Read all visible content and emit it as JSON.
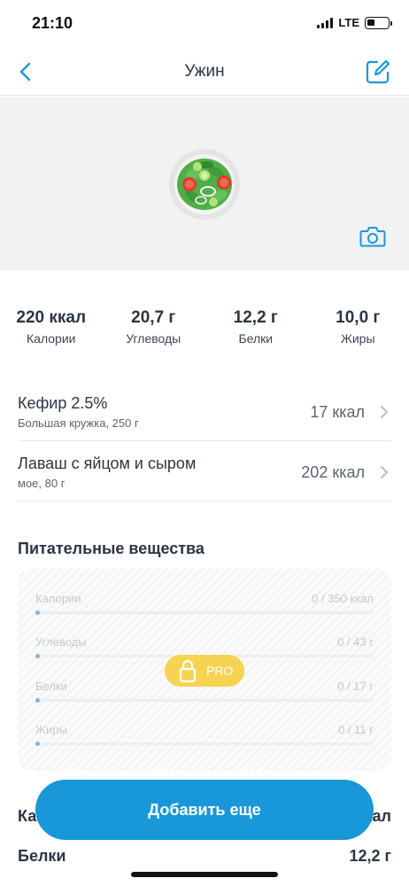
{
  "status_bar": {
    "time": "21:10",
    "network": "LTE",
    "signal_bars": 4,
    "battery_level": 0.35
  },
  "nav": {
    "title": "Ужин",
    "back_icon": "chevron-left-icon",
    "edit_icon": "edit-icon"
  },
  "photo": {
    "food_icon": "salad-icon",
    "camera_icon": "camera-icon"
  },
  "macros": [
    {
      "value": "220 ккал",
      "label": "Калории"
    },
    {
      "value": "20,7 г",
      "label": "Углеводы"
    },
    {
      "value": "12,2 г",
      "label": "Белки"
    },
    {
      "value": "10,0 г",
      "label": "Жиры"
    }
  ],
  "items": [
    {
      "name": "Кефир 2.5%",
      "subtitle": "Большая кружка, 250 г",
      "kcal": "17 ккал"
    },
    {
      "name": "Лаваш с яйцом и сыром",
      "subtitle": "мое, 80 г",
      "kcal": "202 ккал"
    }
  ],
  "nutrients": {
    "title": "Питательные вещества",
    "pro_label": "PRO",
    "rows": [
      {
        "label": "Калории",
        "value": "0 / 350 ккал",
        "progress": 0
      },
      {
        "label": "Углеводы",
        "value": "0 / 43 г",
        "progress": 0
      },
      {
        "label": "Белки",
        "value": "0 / 17 г",
        "progress": 0
      },
      {
        "label": "Жиры",
        "value": "0 / 11 г",
        "progress": 0
      }
    ]
  },
  "totals": [
    {
      "label": "Ка",
      "value": "кал"
    },
    {
      "label": "Белки",
      "value": "12,2 г"
    }
  ],
  "add_button_label": "Добавить еще",
  "colors": {
    "accent": "#1898d8",
    "text_primary": "#2b3542",
    "pro_badge": "#f7d354",
    "photo_background": "#f2f2f2"
  }
}
